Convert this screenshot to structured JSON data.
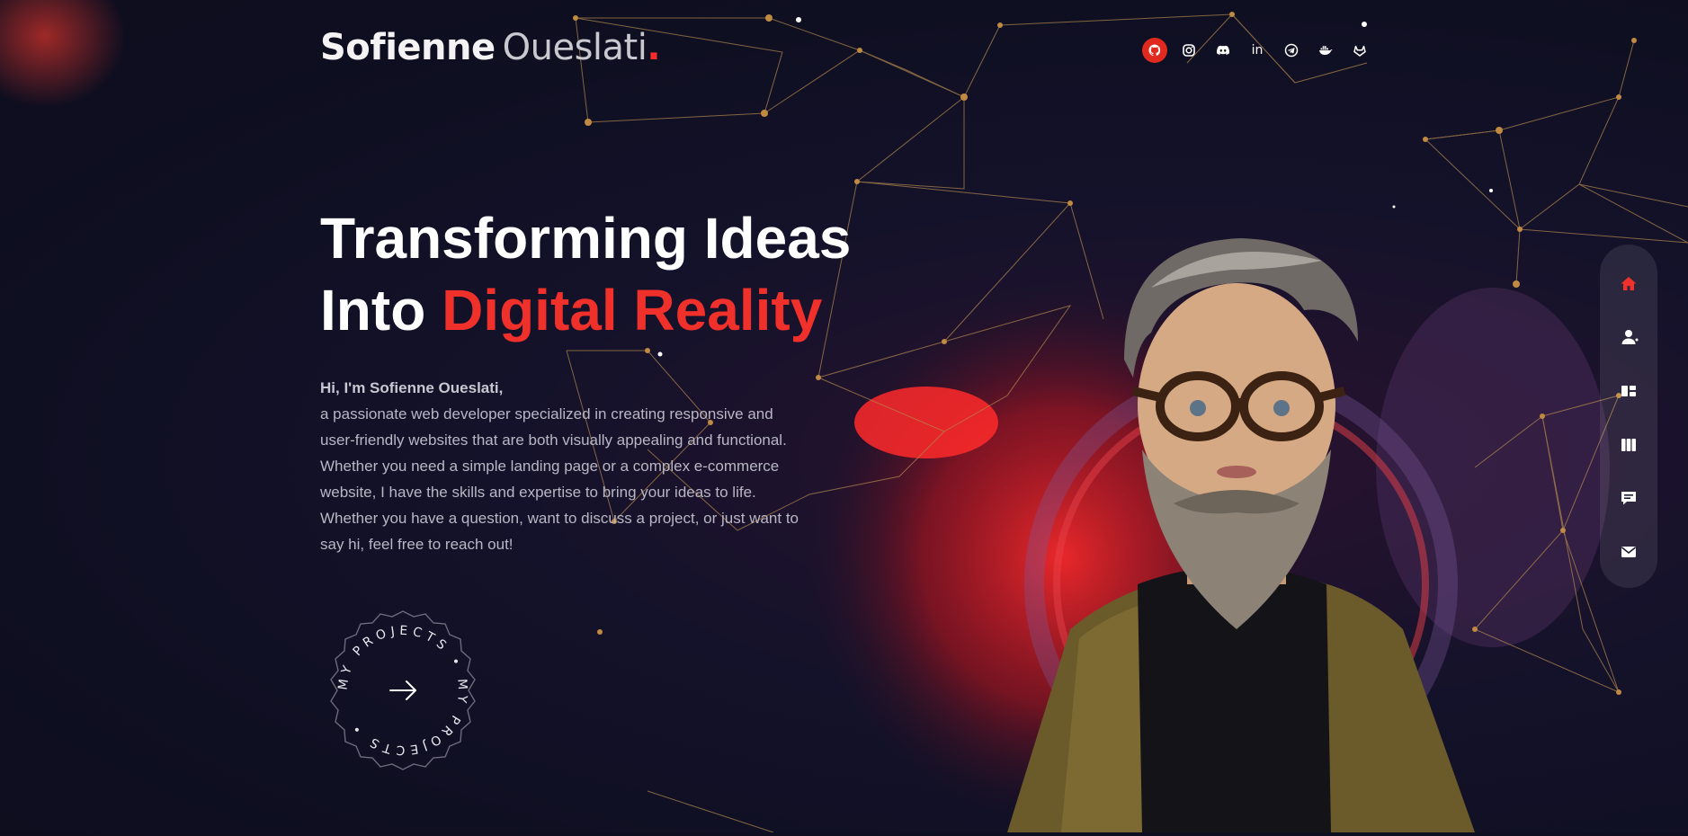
{
  "brand": {
    "first_name": "Sofienne",
    "last_name": "Oueslati",
    "dot": "."
  },
  "socials": [
    {
      "name": "github-icon",
      "active": true
    },
    {
      "name": "instagram-icon",
      "active": false
    },
    {
      "name": "discord-icon",
      "active": false
    },
    {
      "name": "linkedin-icon",
      "label": "in",
      "active": false
    },
    {
      "name": "telegram-icon",
      "active": false
    },
    {
      "name": "docker-icon",
      "active": false
    },
    {
      "name": "gitlab-icon",
      "active": false
    }
  ],
  "hero": {
    "line1": "Transforming Ideas",
    "line2_plain": "Into ",
    "line2_accent": "Digital Reality",
    "greeting": "Hi, I'm Sofienne Oueslati,",
    "paragraph_lines": [
      "a passionate web developer specialized in creating responsive and",
      "user-friendly websites that are both visually appealing and functional.",
      "Whether you need a simple landing page or a complex e-commerce",
      "website, I have the skills and expertise to bring your ideas to life.",
      "Whether you have a question, want to discuss a project, or just want to",
      "say hi, feel free to reach out!"
    ]
  },
  "cta": {
    "circular_text": "MY PROJECTS • MY PROJECTS •",
    "icon": "arrow-right-icon"
  },
  "sidenav": [
    {
      "name": "home-icon",
      "active": true
    },
    {
      "name": "user-icon",
      "active": false
    },
    {
      "name": "services-icon",
      "active": false
    },
    {
      "name": "portfolio-icon",
      "active": false
    },
    {
      "name": "testimonials-icon",
      "active": false
    },
    {
      "name": "mail-icon",
      "active": false
    }
  ],
  "colors": {
    "accent": "#f0302a",
    "background": "#0f0f22",
    "text_muted": "#b9b7c4",
    "network": "#b58a4e"
  }
}
